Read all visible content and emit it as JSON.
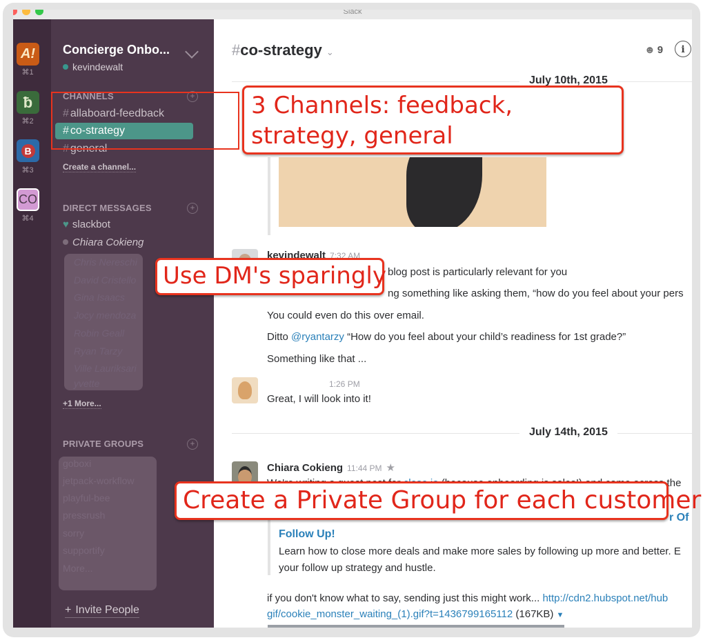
{
  "window": {
    "title": "Slack"
  },
  "teams": [
    {
      "initials": "A!",
      "shortcut": "⌘1",
      "color": "#c95b16"
    },
    {
      "initials": "ƀ",
      "shortcut": "⌘2",
      "color": "#3a6b3b"
    },
    {
      "initials": "B",
      "shortcut": "⌘3",
      "color": "#2c6aa8"
    },
    {
      "initials": "CO",
      "shortcut": "⌘4",
      "color": "#d39ad3"
    }
  ],
  "sidebar": {
    "team_name": "Concierge Onbo...",
    "user": "kevindewalt",
    "channels_header": "CHANNELS",
    "channels": [
      {
        "name": "allaboard-feedback"
      },
      {
        "name": "co-strategy"
      },
      {
        "name": "general"
      }
    ],
    "create_channel": "Create a channel...",
    "dm_header": "DIRECT MESSAGES",
    "dms": [
      {
        "name": "slackbot"
      },
      {
        "name": "Chiara Cokieng"
      }
    ],
    "blurred_dms": [
      "Chris Nereschi",
      "David Cristello",
      "Gina Isaacs",
      "Jocy mendoza",
      "Robin Geall",
      "Ryan Tarzy",
      "Ville Lauriksari",
      "yvette"
    ],
    "more_link": "+1 More...",
    "groups_header": "PRIVATE GROUPS",
    "blurred_groups": [
      "goboxi",
      "jetpack-workflow",
      "playful-bee",
      "pressrush",
      "sorry",
      "supportify",
      "More..."
    ],
    "invite": "Invite People"
  },
  "main": {
    "channel": "co-strategy",
    "member_count": "9",
    "dates": [
      "July 10th, 2015",
      "July 14th, 2015"
    ],
    "messages": [
      {
        "author": "kevindewalt",
        "time": "7:32 AM",
        "lines": [
          "blog post is particularly relevant for you",
          "ng something like asking them, “how do you feel about your pers",
          "You could even do this over email."
        ],
        "ditto_prefix": "Ditto ",
        "ditto_mention": "@ryantarzy",
        "ditto_rest": " “How do you feel about your child’s readiness for 1st grade?”",
        "last": "Something like that ..."
      },
      {
        "time": "1:26 PM",
        "text": "Great, I will look into it!"
      },
      {
        "author": "Chiara Cokieng",
        "time": "11:44 PM",
        "intro_prefix": "We're writing a guest post for ",
        "intro_link": "close.io",
        "intro_rest": " (because onboarding is sales!) and came across the",
        "attach_title_tail": "r Of",
        "attach_title_2": "Follow Up!",
        "attach_desc_1": "Learn how to close more deals and make more sales by following up more and better. E",
        "attach_desc_2": "your follow up strategy and hustle.",
        "follow_text": "if you don't know what to say, sending just this might work... ",
        "follow_link_1": "http://cdn2.hubspot.net/hub",
        "follow_link_2": "gif/cookie_monster_waiting_(1).gif?t=1436799165112",
        "follow_size": " (167KB)"
      }
    ]
  },
  "annotations": {
    "channels": "3 Channels: feedback, strategy, general",
    "dm": "Use DM's sparingly",
    "groups": "Create a Private Group for each customer"
  },
  "colors": {
    "sidebar": "#4d394b",
    "teams": "#3e2b3c",
    "active_channel": "#4c9689",
    "annotation": "#e8331e",
    "link": "#2a80b9"
  }
}
